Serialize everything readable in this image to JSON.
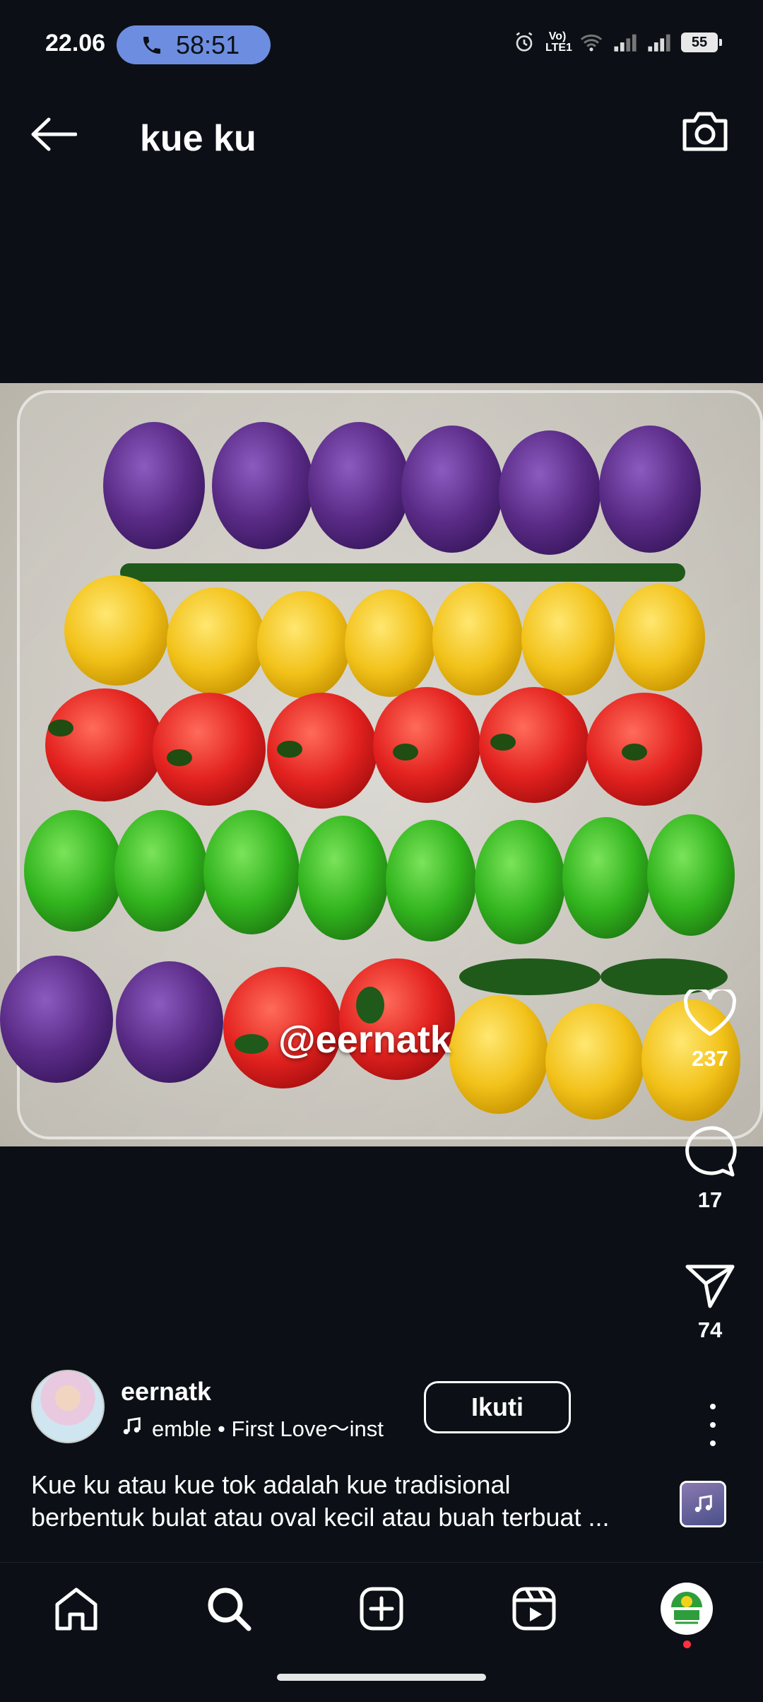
{
  "status_bar": {
    "time": "22.06",
    "call_timer": "58:51",
    "network_label": "Vo) LTE1",
    "battery": "55"
  },
  "header": {
    "title": "kue ku"
  },
  "post": {
    "watermark": "@eernatk",
    "likes": "237",
    "comments": "17",
    "shares": "74",
    "author": {
      "username": "eernatk",
      "audio": "emble • First Love〜inst",
      "follow_label": "Ikuti"
    },
    "caption_lines": [
      "Kue ku atau kue tok adalah kue tradisional",
      "berbentuk bulat atau oval kecil atau buah terbuat ..."
    ]
  },
  "colors": {
    "background": "#0c1016",
    "accent_call": "#6d8ee0",
    "notification": "#ff3040",
    "kue_purple": "#5a2b86",
    "kue_yellow": "#f2c21a",
    "kue_red": "#e3221f",
    "kue_green": "#32b51e"
  },
  "nav": {
    "items": [
      "home-icon",
      "search-icon",
      "create-icon",
      "reels-icon",
      "profile"
    ]
  }
}
